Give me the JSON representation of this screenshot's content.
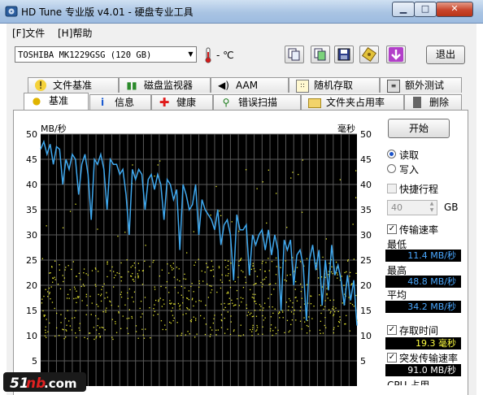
{
  "window": {
    "title": "HD Tune 专业版 v4.01 - 硬盘专业工具"
  },
  "menu": [
    {
      "label": "[F]文件"
    },
    {
      "label": "[H]帮助"
    }
  ],
  "toolbar": {
    "drive": "TOSHIBA MK1229GSG (120 GB)",
    "temperature": "- ℃",
    "exit_label": "退出"
  },
  "tabs": {
    "row1": [
      {
        "label": "文件基准",
        "icon": "exclamation-icon"
      },
      {
        "label": "磁盘监视器",
        "icon": "bar-chart-icon"
      },
      {
        "label": "AAM",
        "icon": "speaker-icon"
      },
      {
        "label": "随机存取",
        "icon": "random-access-icon"
      },
      {
        "label": "额外测试",
        "icon": "extra-tests-icon"
      }
    ],
    "row2": [
      {
        "label": "基准",
        "icon": "lightbulb-icon"
      },
      {
        "label": "信息",
        "icon": "info-icon"
      },
      {
        "label": "健康",
        "icon": "health-cross-icon"
      },
      {
        "label": "错误扫描",
        "icon": "magnifier-icon"
      },
      {
        "label": "文件夹占用率",
        "icon": "folder-icon"
      },
      {
        "label": "删除",
        "icon": "trash-icon"
      }
    ],
    "active": "基准"
  },
  "controls": {
    "start_label": "开始",
    "read_label": "读取",
    "write_label": "写入",
    "quick_label": "快捷行程",
    "gb_value": "40",
    "gb_unit": "GB",
    "transfer_label": "传输速率",
    "min_label": "最低",
    "min_value": "11.4 MB/秒",
    "max_label": "最高",
    "max_value": "48.8 MB/秒",
    "avg_label": "平均",
    "avg_value": "34.2 MB/秒",
    "access_label": "存取时间",
    "access_value": "19.3 毫秒",
    "burst_label": "突发传输速率",
    "burst_value": "91.0 MB/秒",
    "cpu_label": "CPU 占用"
  },
  "watermark": "51nb.com",
  "colors": {
    "chart_bg": "#000000",
    "grid": "#5a5a5a",
    "transfer_line": "#3fa8ee",
    "access_points": "#e8e830"
  },
  "chart_data": {
    "type": "line",
    "y_left_label": "MB/秒",
    "y_right_label": "毫秒",
    "ylim": [
      0,
      50
    ],
    "y_right_lim": [
      0,
      50
    ],
    "yticks": [
      5,
      10,
      15,
      20,
      25,
      30,
      35,
      40,
      45,
      50
    ],
    "x_range": [
      0,
      100
    ],
    "grid": true,
    "series": [
      {
        "name": "传输速率",
        "x": [
          0,
          1,
          2,
          3,
          4,
          5,
          6,
          7,
          8,
          9,
          10,
          11,
          12,
          13,
          14,
          15,
          16,
          17,
          18,
          19,
          20,
          21,
          22,
          23,
          24,
          25,
          26,
          27,
          28,
          29,
          30,
          31,
          32,
          33,
          34,
          35,
          36,
          37,
          38,
          39,
          40,
          41,
          42,
          43,
          44,
          45,
          46,
          47,
          48,
          49,
          50,
          51,
          52,
          53,
          54,
          55,
          56,
          57,
          58,
          59,
          60,
          61,
          62,
          63,
          64,
          65,
          66,
          67,
          68,
          69,
          70,
          71,
          72,
          73,
          74,
          75,
          76,
          77,
          78,
          79,
          80,
          81,
          82,
          83,
          84,
          85,
          86,
          87,
          88,
          89,
          90,
          91,
          92,
          93,
          94,
          95,
          96,
          97,
          98,
          99,
          100
        ],
        "values": [
          47,
          48.5,
          46,
          48,
          44,
          47.5,
          47,
          40,
          45,
          43,
          46,
          45,
          38,
          44,
          46,
          42,
          33,
          45,
          44,
          46,
          43,
          35,
          45,
          44,
          44,
          42,
          43,
          38,
          30,
          43,
          41,
          43,
          42,
          35,
          41,
          42,
          39,
          42,
          40,
          33,
          41,
          40,
          37,
          39,
          27,
          40,
          38,
          35,
          36,
          40,
          30,
          37,
          35,
          34,
          33,
          31,
          35,
          28,
          32,
          33,
          30,
          21,
          34,
          31,
          31,
          32,
          22,
          30,
          28,
          30,
          31,
          27,
          31,
          26,
          30,
          27,
          15,
          29,
          27,
          29,
          20,
          26,
          27,
          24,
          13,
          25,
          28,
          23,
          27,
          16,
          25,
          19,
          28,
          22,
          24,
          21,
          16,
          22,
          17,
          21,
          12
        ]
      },
      {
        "name": "存取时间",
        "type": "scatter",
        "band_ms": [
          9,
          25
        ],
        "average_ms": 19.3,
        "point_count": 700
      }
    ]
  }
}
